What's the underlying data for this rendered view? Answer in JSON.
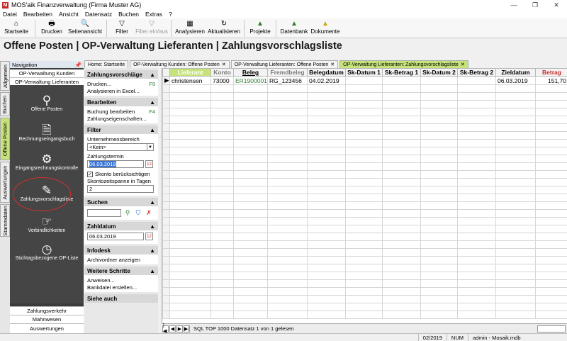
{
  "window": {
    "title": "MOS'aik Finanzverwaltung (Firma Muster AG)",
    "minimize": "—",
    "restore": "❐",
    "close": "✕"
  },
  "menu": [
    "Datei",
    "Bearbeiten",
    "Ansicht",
    "Datensatz",
    "Buchen",
    "Extras",
    "?"
  ],
  "toolbar": [
    {
      "label": "Startseite",
      "icon": "home-icon",
      "glyph": "⌂",
      "disabled": false
    },
    {
      "label": "Drucken",
      "icon": "printer-icon",
      "glyph": "🖶",
      "disabled": false
    },
    {
      "label": "Seitenansicht",
      "icon": "preview-icon",
      "glyph": "🔍",
      "disabled": false
    },
    {
      "label": "Filter",
      "icon": "filter-icon",
      "glyph": "▽",
      "disabled": false
    },
    {
      "label": "Filter ein/aus",
      "icon": "filter-toggle-icon",
      "glyph": "▽",
      "disabled": true
    },
    {
      "label": "Analysieren",
      "icon": "analyze-icon",
      "glyph": "▦",
      "disabled": false
    },
    {
      "label": "Aktualisieren",
      "icon": "refresh-icon",
      "glyph": "↻",
      "disabled": false
    },
    {
      "label": "Projekte",
      "icon": "projects-icon",
      "glyph": "▲",
      "disabled": false
    },
    {
      "label": "Datenbank",
      "icon": "database-icon",
      "glyph": "▲",
      "disabled": false
    },
    {
      "label": "Dokumente",
      "icon": "documents-icon",
      "glyph": "▲",
      "disabled": false
    }
  ],
  "page_title": "Offene Posten | OP-Verwaltung Lieferanten | Zahlungsvorschlagsliste",
  "vtabs": [
    "Allgemein",
    "Buchen",
    "Offene Posten",
    "Auswertungen",
    "Stammdaten"
  ],
  "nav": {
    "header": "Navigation",
    "pin": "📌",
    "sub1": "OP-Verwaltung Kunden",
    "sub2": "OP-Verwaltung Lieferanten",
    "entries": [
      {
        "label": "Offene Posten",
        "glyph": "⚲",
        "icon": "open-items-icon"
      },
      {
        "label": "Rechnungseingangsbuch",
        "glyph": "🗎",
        "icon": "invoice-book-icon"
      },
      {
        "label": "Eingangsrechnungskontrolle",
        "glyph": "⚙",
        "icon": "invoice-control-icon"
      },
      {
        "label": "Zahlungsvorschlagsliste",
        "glyph": "✎",
        "icon": "payment-proposal-icon"
      },
      {
        "label": "Verbindlichkeiten",
        "glyph": "☞",
        "icon": "liabilities-icon"
      },
      {
        "label": "Stichtagsbezogene OP-Liste",
        "glyph": "◷",
        "icon": "clock-icon"
      }
    ],
    "bottom": [
      "Zahlungsverkehr",
      "Mahnwesen",
      "Auswertungen"
    ]
  },
  "doc_tabs": [
    {
      "label": "Home: Startseite",
      "active": false
    },
    {
      "label": "OP-Verwaltung Kunden: Offene Posten",
      "active": false
    },
    {
      "label": "OP-Verwaltung Lieferanten: Offene Posten",
      "active": false
    },
    {
      "label": "OP-Verwaltung Lieferanten: Zahlungsvorschlagsliste",
      "active": true
    }
  ],
  "tasks": {
    "zv": {
      "title": "Zahlungsvorschläge",
      "print": "Drucken...",
      "print_key": "F9",
      "excel": "Analysieren in Excel..."
    },
    "edit": {
      "title": "Bearbeiten",
      "booking": "Buchung bearbeiten",
      "booking_key": "F4",
      "props": "Zahlungseigenschaften..."
    },
    "filter": {
      "title": "Filter",
      "unit_label": "Unternehmensbereich",
      "unit_value": "<Kein>",
      "date_label": "Zahlungstermin",
      "date_value": "06.03.2019",
      "skonto_label": "Skonto berücksichtigen",
      "skonto_checked": true,
      "span_label": "Skontozeitspanne in Tagen",
      "span_value": "2"
    },
    "search": {
      "title": "Suchen"
    },
    "pay": {
      "title": "Zahldatum",
      "value": "06.03.2019"
    },
    "infodesk": {
      "title": "Infodesk",
      "link": "Archivordner anzeigen"
    },
    "more": {
      "title": "Weitere Schritte",
      "l1": "Anweisen...",
      "l2": "Bankdatei erstellen..."
    },
    "cut": "Siehe auch",
    "collapse": "▲"
  },
  "grid": {
    "columns": [
      "Lieferant",
      "Konto",
      "Beleg",
      "Fremdbeleg",
      "Belegdatum",
      "Sk-Datum 1",
      "Sk-Betrag 1",
      "Sk-Datum 2",
      "Sk-Betrag 2",
      "Zieldatum",
      "Betrag"
    ],
    "rows": [
      [
        "christensen",
        "73000",
        "ER1900001",
        "RG_123456",
        "04.02.2019",
        "",
        "",
        "",
        "",
        "06.03.2019",
        "151,70"
      ]
    ],
    "row_marker": "▶",
    "footer": "SQL TOP 1000 Datensatz 1 von 1 gelesen"
  },
  "status": [
    "02/2019",
    "NUM",
    "admin - Mosaik.mdb"
  ]
}
